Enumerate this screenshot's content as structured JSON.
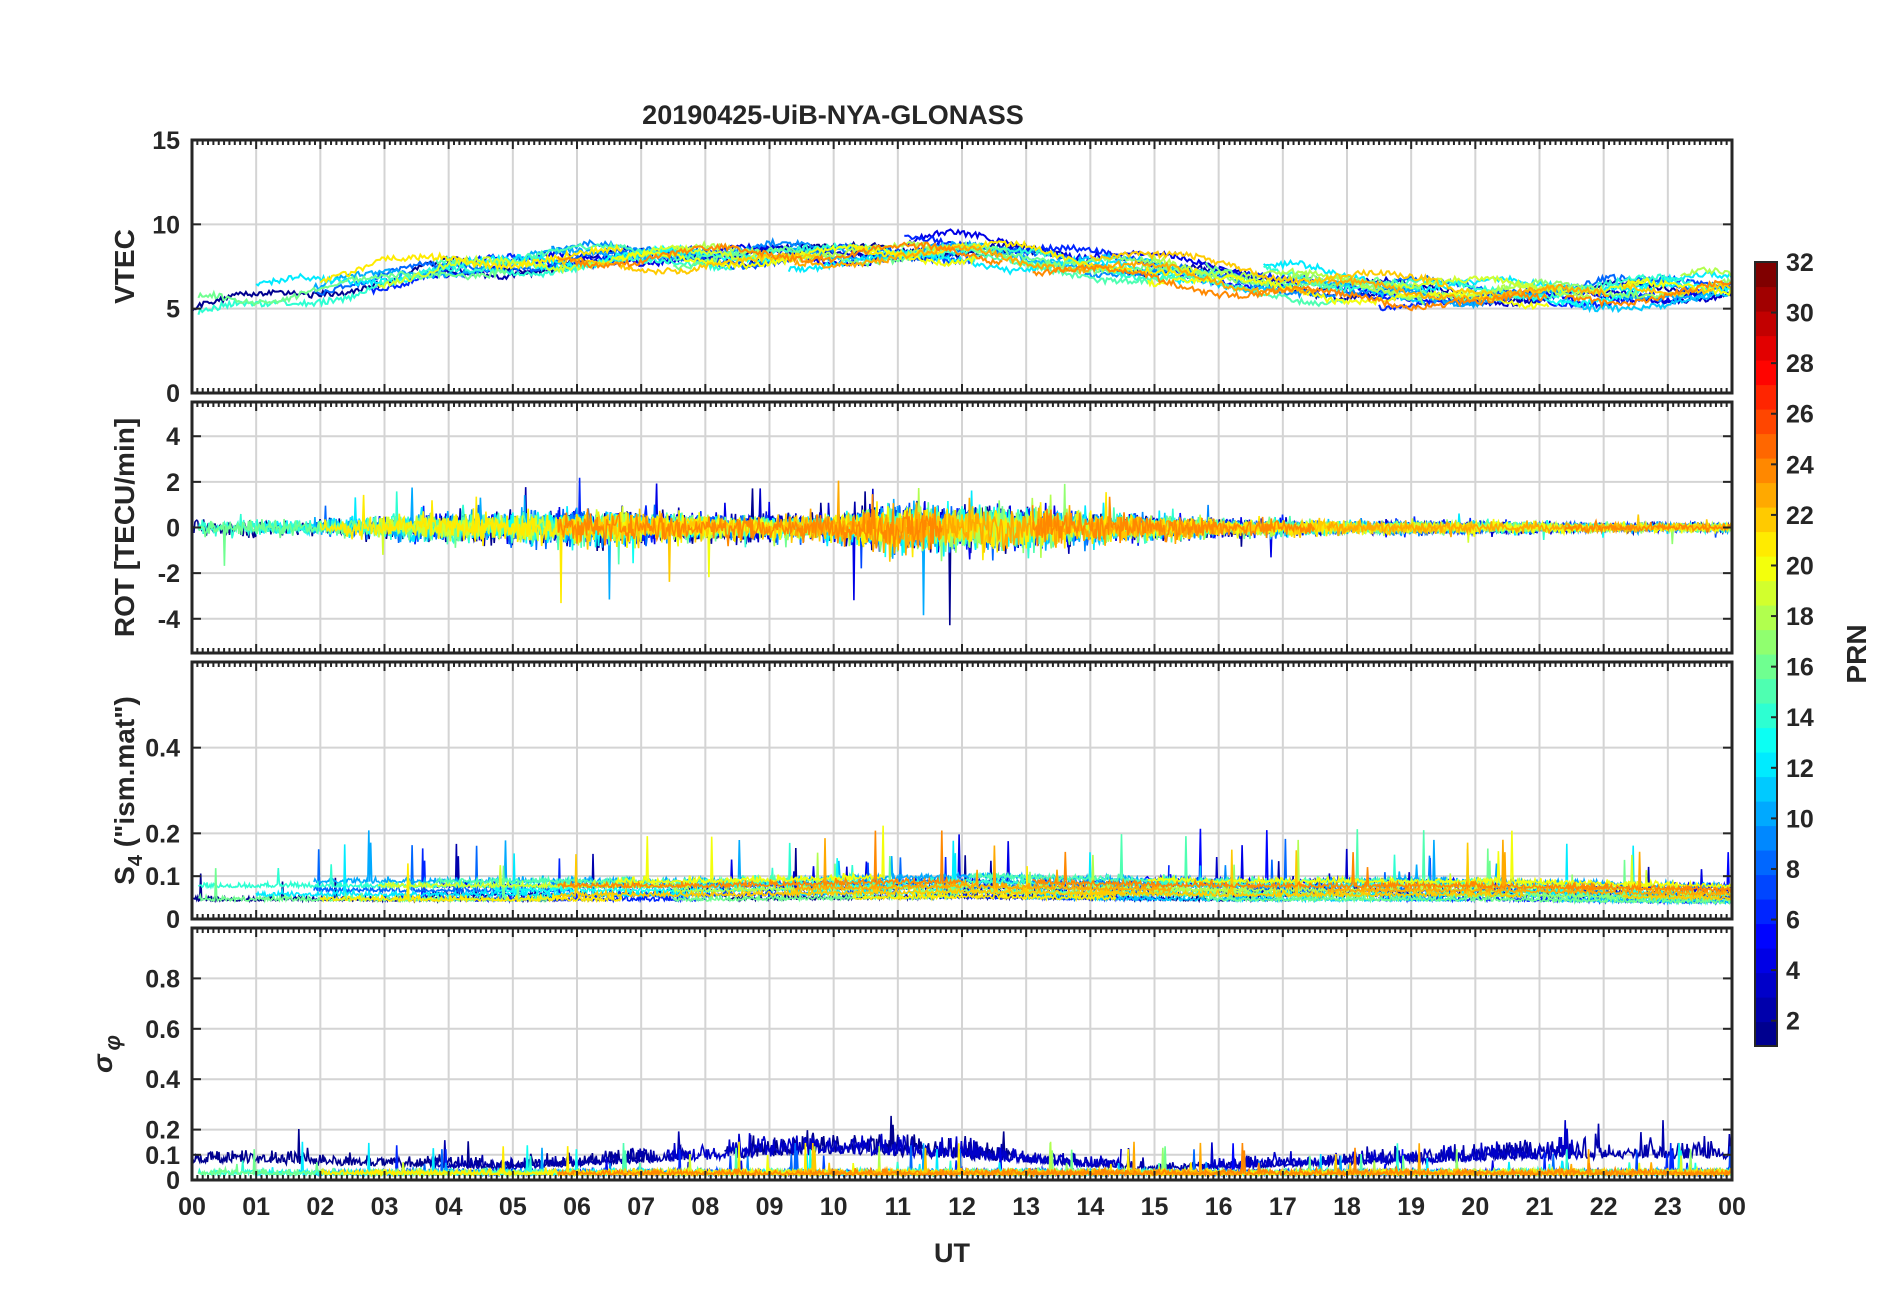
{
  "figure": {
    "title": "20190425-UiB-NYA-GLONASS",
    "xlabel": "UT",
    "x_tick_labels": [
      "00",
      "01",
      "02",
      "03",
      "04",
      "05",
      "06",
      "07",
      "08",
      "09",
      "10",
      "11",
      "12",
      "13",
      "14",
      "15",
      "16",
      "17",
      "18",
      "19",
      "20",
      "21",
      "22",
      "23",
      "00"
    ]
  },
  "colorbar": {
    "label": "PRN",
    "range": [
      1,
      32
    ],
    "tick_labels": [
      "2",
      "4",
      "6",
      "8",
      "10",
      "12",
      "14",
      "16",
      "18",
      "20",
      "22",
      "24",
      "26",
      "28",
      "30",
      "32"
    ],
    "colormap": "jet",
    "colormap_stops": [
      "#00008f",
      "#0000ff",
      "#0080ff",
      "#00ffff",
      "#80ff80",
      "#ffff00",
      "#ff8000",
      "#ff0000",
      "#800000"
    ]
  },
  "chart_data": [
    {
      "type": "line",
      "panel": "vtec",
      "ylabel": "VTEC",
      "ylim": [
        0,
        15
      ],
      "y_tick_labels": [
        "0",
        "5",
        "10",
        "15"
      ],
      "xlim": [
        0,
        24
      ],
      "grid": true,
      "series_description": "GLONASS satellites, colored by PRN",
      "approx_profile": {
        "x": [
          0,
          2,
          4,
          6,
          8,
          10,
          12,
          14,
          16,
          18,
          20,
          22,
          24
        ],
        "y": [
          5.2,
          6.3,
          7.5,
          8.0,
          8.2,
          8.3,
          8.6,
          7.8,
          7.0,
          6.2,
          5.9,
          6.0,
          6.3
        ]
      }
    },
    {
      "type": "line",
      "panel": "rot",
      "ylabel": "ROT [TECU/min]",
      "ylim": [
        -5.5,
        5.5
      ],
      "y_tick_labels": [
        "-4",
        "-2",
        "0",
        "2",
        "4"
      ],
      "xlim": [
        0,
        24
      ],
      "grid": true,
      "series_description": "GLONASS satellites, colored by PRN",
      "approx_amplitude": {
        "x": [
          0,
          2,
          4,
          6,
          8,
          10,
          11,
          12,
          13,
          14,
          16,
          18,
          20,
          22,
          24
        ],
        "y": [
          0.4,
          0.4,
          0.7,
          0.8,
          0.6,
          0.6,
          1.1,
          1.0,
          1.0,
          0.7,
          0.4,
          0.3,
          0.3,
          0.2,
          0.2
        ]
      }
    },
    {
      "type": "line",
      "panel": "s4",
      "ylabel": "S4 (\"ism.mat\")",
      "ylabel_main": "S",
      "ylabel_sub": "4",
      "ylabel_rest": " (\"ism.mat\")",
      "ylim": [
        0,
        0.6
      ],
      "y_tick_labels": [
        "0",
        "0.1",
        "0.2",
        "0.4"
      ],
      "xlim": [
        0,
        24
      ],
      "grid": true,
      "series_description": "GLONASS satellites, colored by PRN",
      "approx_baseline": {
        "x": [
          0,
          4,
          8,
          12,
          16,
          20,
          24
        ],
        "y": [
          0.07,
          0.07,
          0.07,
          0.08,
          0.07,
          0.07,
          0.06
        ]
      }
    },
    {
      "type": "line",
      "panel": "sigma_phi",
      "ylabel": "σ φ",
      "ylim": [
        0,
        1
      ],
      "y_tick_labels": [
        "0",
        "0.1",
        "0.2",
        "0.4",
        "0.6",
        "0.8"
      ],
      "xlim": [
        0,
        24
      ],
      "grid": true,
      "series_description": "GLONASS satellites, colored by PRN",
      "approx_baseline": {
        "x": [
          0,
          5,
          10,
          12,
          15,
          21,
          24
        ],
        "y": [
          0.1,
          0.06,
          0.15,
          0.12,
          0.05,
          0.12,
          0.12
        ]
      }
    }
  ]
}
